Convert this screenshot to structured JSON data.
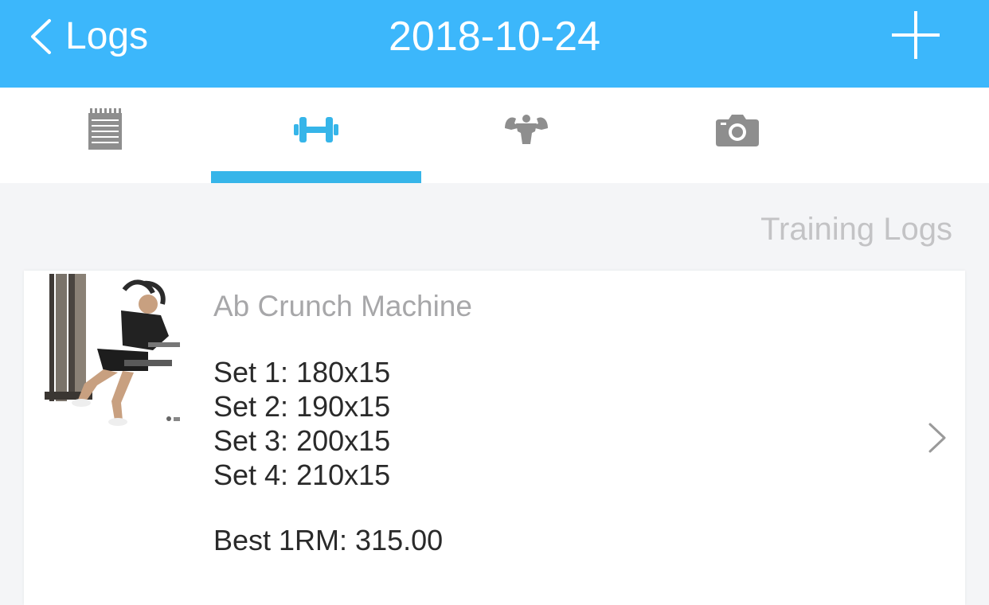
{
  "navbar": {
    "back_label": "Logs",
    "title": "2018-10-24",
    "back_icon": "chevron-left-icon",
    "add_icon": "plus-icon",
    "background": "#3cb7fb"
  },
  "tabs": [
    {
      "name": "notes",
      "icon": "notepad-icon",
      "active": false
    },
    {
      "name": "workouts",
      "icon": "dumbbell-icon",
      "active": true
    },
    {
      "name": "body",
      "icon": "muscle-icon",
      "active": false
    },
    {
      "name": "photos",
      "icon": "camera-icon",
      "active": false
    }
  ],
  "accent": "#36b5e9",
  "section": {
    "title": "Training Logs"
  },
  "entry": {
    "exercise": "Ab Crunch Machine",
    "thumbnail": "ab-crunch-machine-photo",
    "sets": [
      "Set 1: 180x15",
      "Set 2: 190x15",
      "Set 3: 200x15",
      "Set 4: 210x15"
    ],
    "best_1rm": "Best 1RM: 315.00"
  }
}
